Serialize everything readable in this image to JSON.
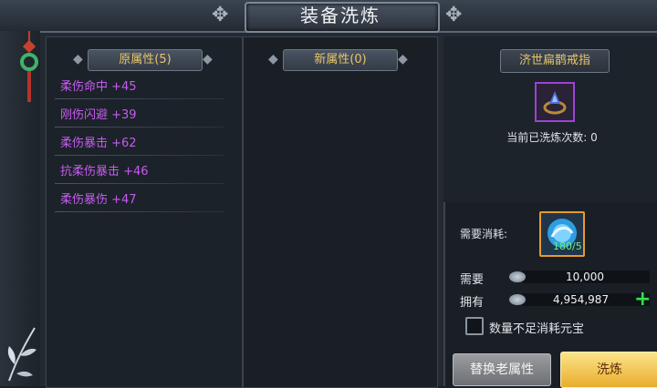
{
  "window": {
    "title": "装备洗炼"
  },
  "old_attributes": {
    "header": "原属性(5)",
    "items": [
      "柔伤命中 +45",
      "刚伤闪避 +39",
      "柔伤暴击 +62",
      "抗柔伤暴击 +46",
      "柔伤暴伤 +47"
    ]
  },
  "new_attributes": {
    "header": "新属性(0)"
  },
  "item": {
    "name": "济世扁鹊戒指",
    "wash_count_text": "当前已洗炼次数: 0",
    "icon": "ring-item-icon"
  },
  "cost": {
    "consume_label": "需要消耗:",
    "material_count": "180/5",
    "need_label": "需要",
    "need_value": "10,000",
    "own_label": "拥有",
    "own_value": "4,954,987",
    "use_gold_label": "数量不足消耗元宝"
  },
  "buttons": {
    "replace": "替换老属性",
    "wash": "洗炼"
  },
  "colors": {
    "attr_purple": "#c65bf0",
    "header_gold": "#e8c56a",
    "plus_green": "#35e04a",
    "item_border": "#9d42d8",
    "material_border": "#e89a2a"
  }
}
